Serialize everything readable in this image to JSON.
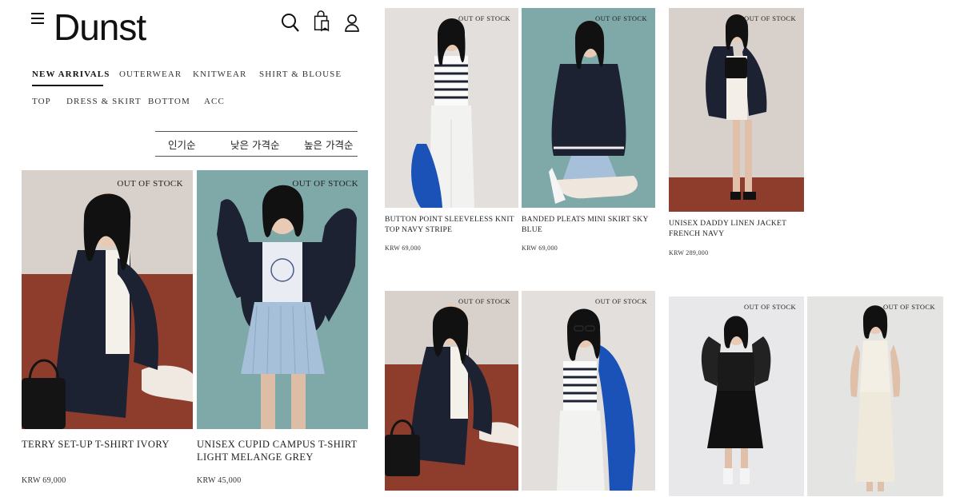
{
  "header": {
    "brand": "Dunst"
  },
  "icons": {
    "menu": "hamburger-menu-icon",
    "search": "search-icon",
    "bag": "shopping-bag-icon",
    "account": "user-icon"
  },
  "nav": {
    "row1": [
      "NEW ARRIVALS",
      "OUTERWEAR",
      "KNITWEAR",
      "SHIRT & BLOUSE"
    ],
    "row2": [
      "TOP",
      "DRESS & SKIRT",
      "BOTTOM",
      "ACC"
    ],
    "active": "NEW ARRIVALS"
  },
  "sort": [
    "인기순",
    "낮은 가격순",
    "높은 가격순"
  ],
  "colors": {
    "text": "#1a1a1a",
    "wall_warm": "#d8d2ce",
    "floor_terracotta": "#8e3d2c",
    "teal_backdrop": "#7ea9a8",
    "navy": "#1d2233",
    "cobalt": "#1a52b8"
  },
  "products": [
    {
      "name": "TERRY SET-UP T-SHIRT IVORY",
      "price": "KRW 69,000",
      "status": "OUT OF STOCK"
    },
    {
      "name": "UNISEX CUPID CAMPUS T-SHIRT LIGHT MELANGE GREY",
      "price": "KRW 45,000",
      "status": "OUT OF STOCK"
    },
    {
      "name": "BUTTON POINT SLEEVELESS KNIT TOP NAVY STRIPE",
      "price": "KRW 69,000",
      "status": "OUT OF STOCK"
    },
    {
      "name": "BANDED PLEATS MINI SKIRT SKY BLUE",
      "price": "KRW 69,000",
      "status": "OUT OF STOCK"
    },
    {
      "name": "UNISEX DADDY LINEN JACKET FRENCH NAVY",
      "price": "KRW 289,000",
      "status": "OUT OF STOCK"
    },
    {
      "name": "",
      "price": "",
      "status": "OUT OF STOCK"
    },
    {
      "name": "",
      "price": "",
      "status": "OUT OF STOCK"
    },
    {
      "name": "",
      "price": "",
      "status": "OUT OF STOCK"
    },
    {
      "name": "",
      "price": "",
      "status": "OUT OF STOCK"
    }
  ]
}
